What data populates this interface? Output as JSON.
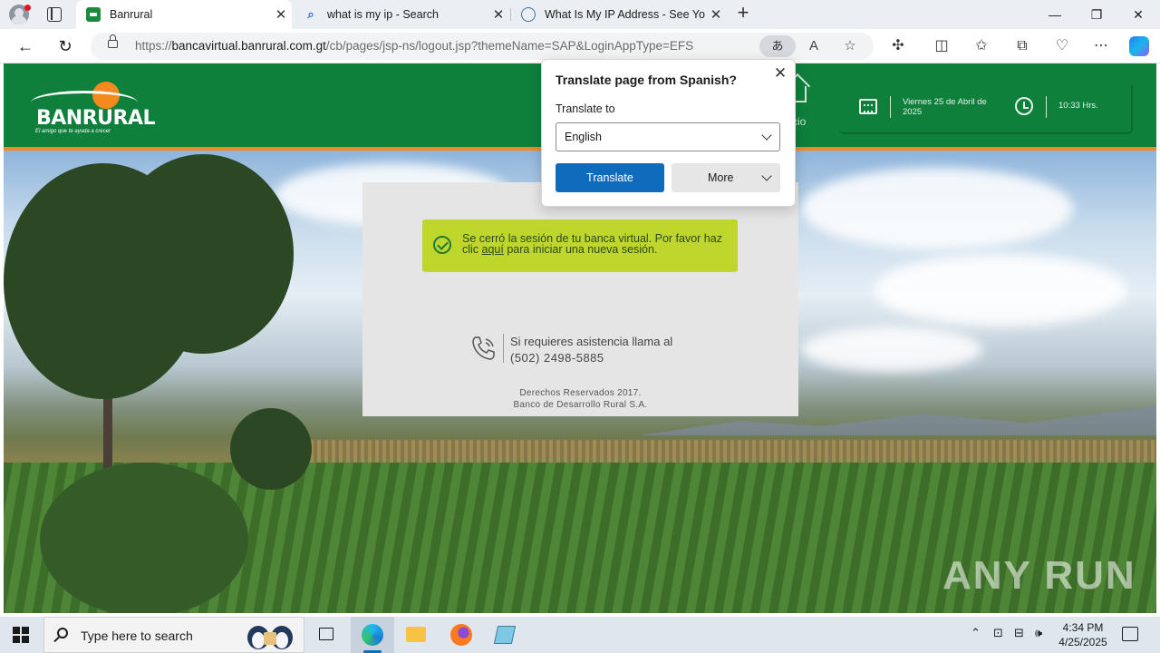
{
  "browser": {
    "tabs": [
      {
        "title": "Banrural",
        "active": true,
        "icon": "banrural-favicon"
      },
      {
        "title": "what is my ip - Search",
        "active": false,
        "icon": "search-favicon"
      },
      {
        "title": "What Is My IP Address - See Your",
        "active": false,
        "icon": "globe-favicon"
      }
    ],
    "url_prefix": "https://",
    "url_host": "bancavirtual.banrural.com.gt",
    "url_path": "/cb/pages/jsp-ns/logout.jsp?themeName=SAP&LoginAppType=EFS",
    "translate_pill": "あ",
    "read_aloud_icon": "A"
  },
  "site": {
    "logo_name": "BANRURAL",
    "logo_tagline": "El amigo que te ayuda a crecer",
    "home_label": "cio",
    "date": "Viernes 25 de Abril de 2025",
    "time": "10:33 Hrs.",
    "accent": "#0f7f3c",
    "orange": "#f08a1c"
  },
  "logout": {
    "message_before": "Se cerró la sesión de tu banca virtual. Por favor haz clic ",
    "link_text": "aquí",
    "message_after": " para iniciar una nueva sesión.",
    "help_line1": "Si requieres asistencia llama al",
    "help_line2": "(502) 2498-5885",
    "footer_line1": "Derechos Reservados 2017.",
    "footer_line2": "Banco de Desarrollo Rural S.A."
  },
  "translate_popup": {
    "title": "Translate page from Spanish?",
    "label": "Translate to",
    "selected_language": "English",
    "translate_button": "Translate",
    "more_button": "More"
  },
  "watermark": "ANY RUN",
  "taskbar": {
    "search_placeholder": "Type here to search",
    "time": "4:34 PM",
    "date": "4/25/2025"
  }
}
